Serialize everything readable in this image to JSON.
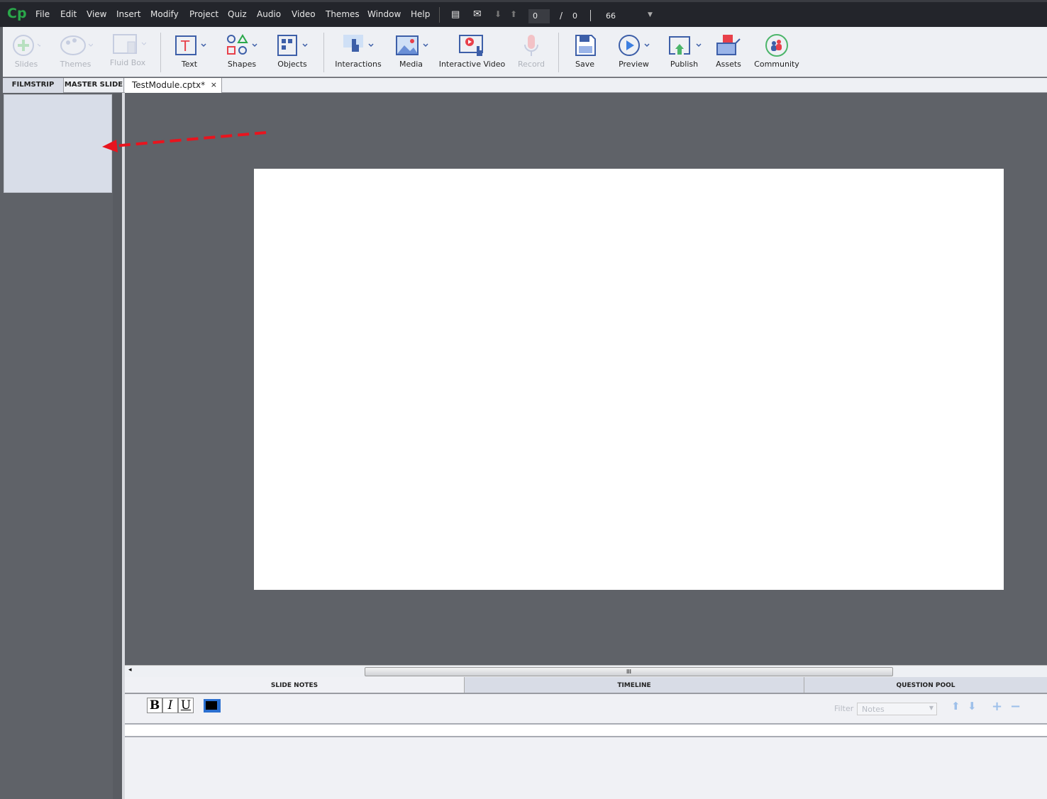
{
  "app": {
    "logo": "Cp"
  },
  "menu": [
    "File",
    "Edit",
    "View",
    "Insert",
    "Modify",
    "Project",
    "Quiz",
    "Audio",
    "Video",
    "Themes",
    "Window",
    "Help"
  ],
  "nav": {
    "current_slide": "0",
    "separator": "/",
    "total_slides": "0",
    "zoom": "66"
  },
  "toolbar": [
    {
      "label": "Slides",
      "icon": "plus-circle-icon",
      "disabled": true
    },
    {
      "label": "Themes",
      "icon": "palette-icon",
      "disabled": true
    },
    {
      "label": "Fluid Box",
      "icon": "fluid-box-icon",
      "disabled": true
    },
    {
      "label": "Text",
      "icon": "text-icon"
    },
    {
      "label": "Shapes",
      "icon": "shapes-icon"
    },
    {
      "label": "Objects",
      "icon": "objects-icon"
    },
    {
      "label": "Interactions",
      "icon": "hand-pointer-icon"
    },
    {
      "label": "Media",
      "icon": "image-icon"
    },
    {
      "label": "Interactive Video",
      "icon": "interactive-video-icon"
    },
    {
      "label": "Record",
      "icon": "microphone-icon",
      "disabled": true
    },
    {
      "label": "Save",
      "icon": "floppy-icon"
    },
    {
      "label": "Preview",
      "icon": "play-icon"
    },
    {
      "label": "Publish",
      "icon": "publish-icon"
    },
    {
      "label": "Assets",
      "icon": "box-icon"
    },
    {
      "label": "Community",
      "icon": "community-icon"
    }
  ],
  "panel_tabs": {
    "filmstrip": "FILMSTRIP",
    "master_slide": "MASTER SLIDE",
    "document": "TestModule.cptx*",
    "close": "×"
  },
  "bottom_tabs": [
    "SLIDE NOTES",
    "TIMELINE",
    "QUESTION POOL"
  ],
  "notes": {
    "bold": "B",
    "italic": "I",
    "underline": "U",
    "filter_label": "Filter",
    "filter_value": "Notes"
  },
  "scroll_grip": "III",
  "colors": {
    "accent": "#2aa84a",
    "annotation_arrow": "#e8141e",
    "menubar": "#23252b",
    "workspace": "#5f6268"
  }
}
